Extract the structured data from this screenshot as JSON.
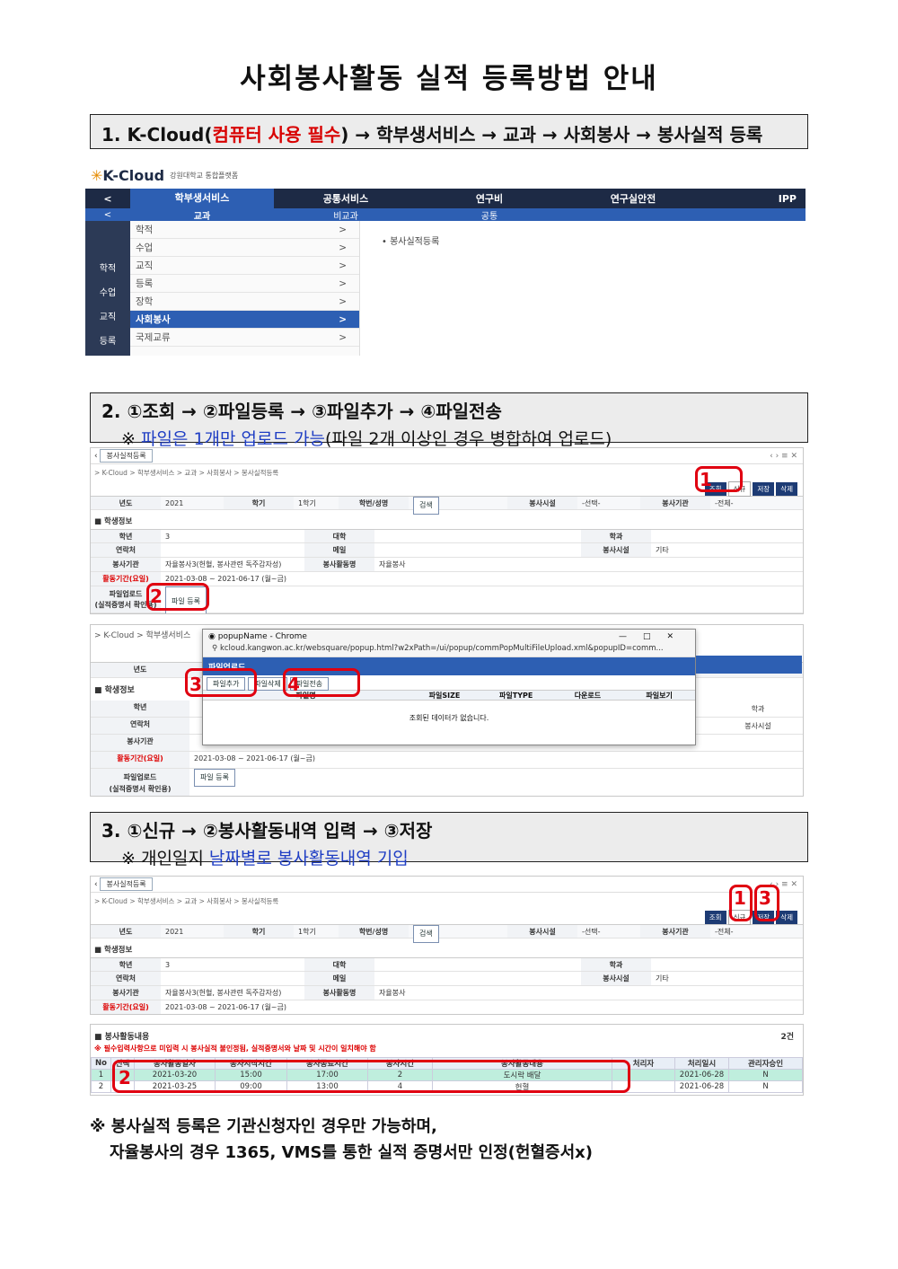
{
  "title": "사회봉사활동 실적 등록방법 안내",
  "step1": {
    "prefix": "1. K-Cloud(",
    "highlight": "컴퓨터 사용 필수",
    "suffix": ") → 학부생서비스 → 교과 → 사회봉사 → 봉사실적 등록"
  },
  "kcloud": {
    "logo": "K-Cloud",
    "logo_sub": "강원대학교 통합플랫폼",
    "nav": [
      "<",
      "학부생서비스",
      "공통서비스",
      "연구비",
      "연구실안전",
      "IPP"
    ],
    "subnav": [
      "<",
      "교과",
      "비교과",
      "공통"
    ],
    "left_items": [
      "학적",
      "수업",
      "교직",
      "등록"
    ],
    "menu": [
      "학적",
      "수업",
      "교직",
      "등록",
      "장학",
      "사회봉사",
      "국제교류"
    ],
    "menu_active": "사회봉사",
    "right_item": "• 봉사실적등록"
  },
  "step2": {
    "line1": "2. ①조회 → ②파일등록 → ③파일추가 → ④파일전송",
    "note_mark": "※ ",
    "note_blue": "파일은 1개만 업로드 가능",
    "note_rest": "(파일 2개 이상인 경우 병합하여 업로드)"
  },
  "form": {
    "tab": "봉사실적등록",
    "breadcrumb": "> K-Cloud > 학부생서비스 > 교과 > 사회봉사 > 봉사실적등록",
    "buttons": [
      "조회",
      "신규",
      "저장",
      "삭제"
    ],
    "search": {
      "year_label": "년도",
      "year": "2021",
      "term_label": "학기",
      "term": "1학기",
      "student_label": "학번/성명",
      "search_btn": "검색",
      "facility_label": "봉사시설",
      "facility": "-선택-",
      "period_label": "봉사기관",
      "period": "-전체-"
    },
    "section": "학생정보",
    "grade_label": "학년",
    "grade": "3",
    "univ_label": "대학",
    "dept_label": "학과",
    "contact_label": "연락처",
    "email_label": "메일",
    "facility_label": "봉사시설",
    "facility_val": "기타",
    "org_label": "봉사기관",
    "org_val": "자율봉사3(헌혈, 봉사관련 독주감자성)",
    "type_label": "봉사활동명",
    "type_val": "자율봉사",
    "period_label": "활동기간(요일)",
    "period_val": "2021-03-08 ~ 2021-06-17 (월~금)",
    "upload_label": "파일업로드",
    "upload_sub": "(실적증명서 확인용)",
    "upload_btn": "파일 등록"
  },
  "popup": {
    "window_title": "popupName - Chrome",
    "url": "kcloud.kangwon.ac.kr/websquare/popup.html?w2xPath=/ui/popup/commPopMultiFileUpload.xml&popupID=comm...",
    "header": "파일업로드",
    "btn_add": "파일추가",
    "btn_del": "파일삭제",
    "btn_send": "파일전송",
    "cols": [
      "파일명",
      "파일SIZE",
      "파일TYPE",
      "다운로드",
      "파일보기"
    ],
    "empty": "조회된 데이터가 없습니다.",
    "controls": [
      "—",
      "□",
      "✕"
    ]
  },
  "step3": {
    "line1": "3. ①신규 → ②봉사활동내역 입력 → ③저장",
    "note_mark": "※ 개인일지 ",
    "note_blue": "날짜별로 봉사활동내역 기입"
  },
  "activity": {
    "title": "봉사활동내용",
    "count": "2건",
    "warning": "※ 필수입력사항으로 미입력 시 봉사실적 불인정됨, 실적증명서와 날짜 및 시간이 일치해야 함",
    "headers": [
      "No",
      "선택",
      "봉사활동일자",
      "봉사시작시간",
      "봉사종료시간",
      "봉사시간",
      "봉사활동내용",
      "처리자",
      "처리일시",
      "관리자승인"
    ],
    "rows": [
      [
        "1",
        "",
        "2021-03-20",
        "15:00",
        "17:00",
        "2",
        "도시락 배달",
        "",
        "2021-06-28",
        "N"
      ],
      [
        "2",
        "",
        "2021-03-25",
        "09:00",
        "13:00",
        "4",
        "헌혈",
        "",
        "2021-06-28",
        "N"
      ]
    ]
  },
  "markers": {
    "m1": "1",
    "m2": "2",
    "m3": "3",
    "m4": "4"
  },
  "footnote": {
    "line1": "※ 봉사실적 등록은 기관신청자인 경우만 가능하며,",
    "line2": "자율봉사의 경우 1365, VMS를 통한 실적 증명서만 인정(헌혈증서x)"
  },
  "colors": {
    "navy": "#1d2a45",
    "blue": "#2d5fb3",
    "red": "#e00010",
    "step_bg": "#ececec"
  }
}
